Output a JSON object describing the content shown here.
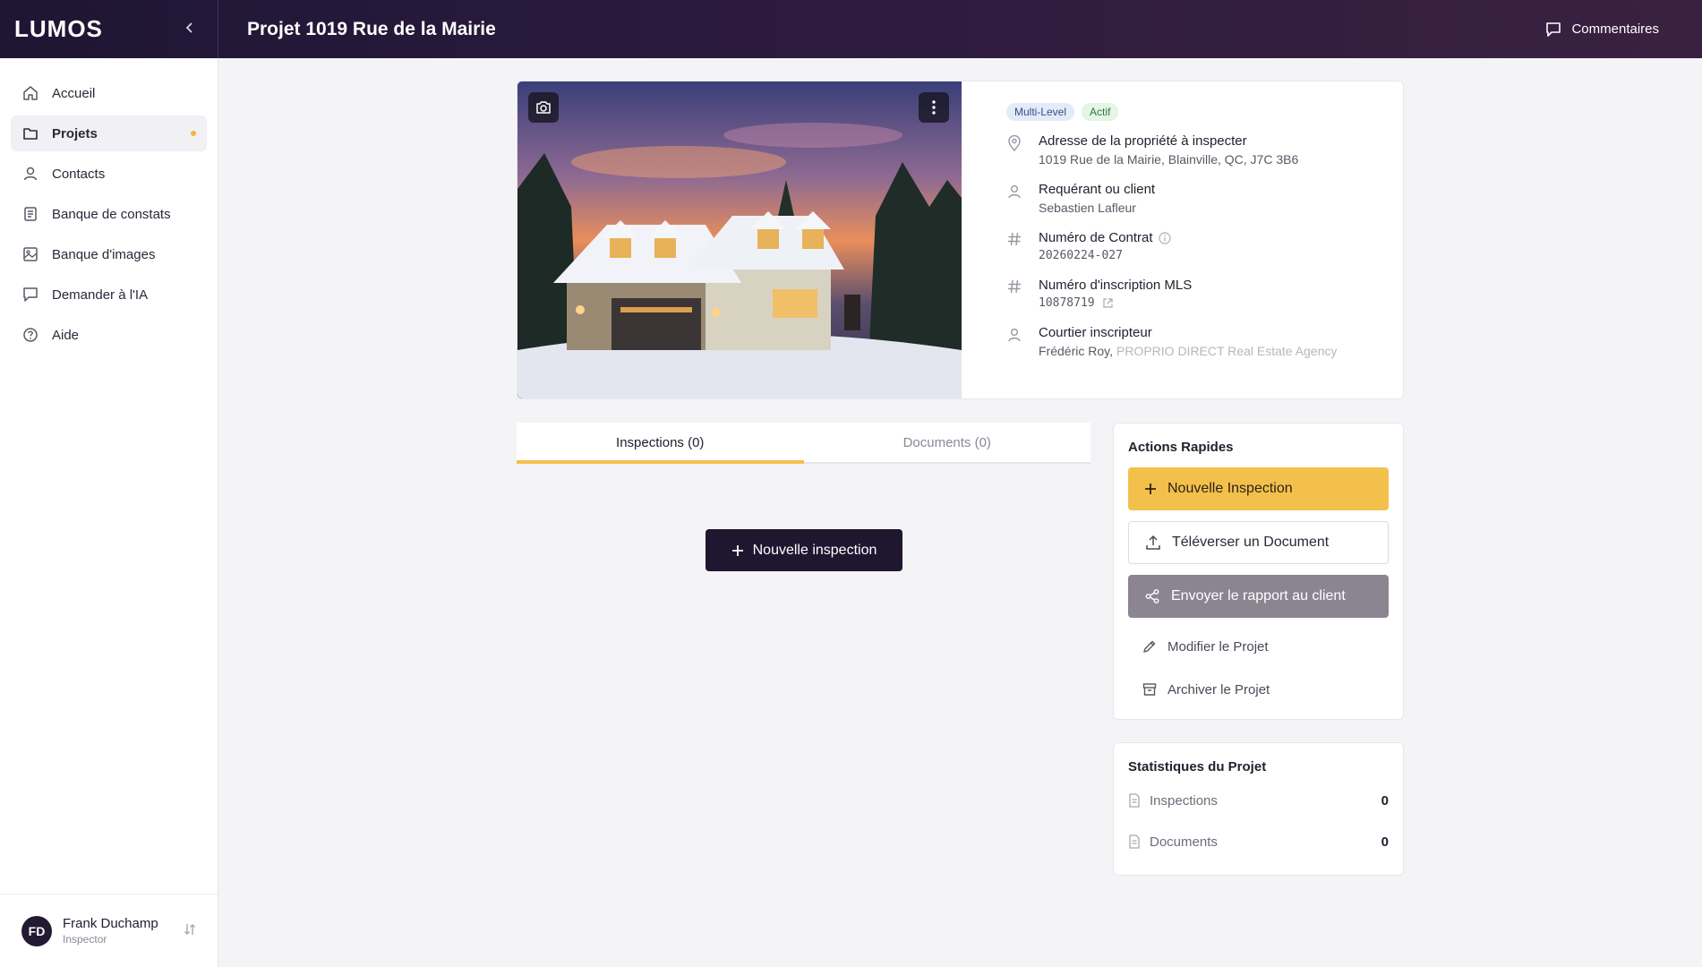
{
  "app": {
    "logo_text": "LUMOS",
    "page_title": "Projet 1019 Rue de la Mairie",
    "comments_label": "Commentaires"
  },
  "sidebar": {
    "items": [
      {
        "label": "Accueil",
        "icon": "home-icon"
      },
      {
        "label": "Projets",
        "icon": "folder-icon",
        "active": true
      },
      {
        "label": "Contacts",
        "icon": "user-icon"
      },
      {
        "label": "Banque de constats",
        "icon": "document-icon"
      },
      {
        "label": "Banque d'images",
        "icon": "image-icon"
      },
      {
        "label": "Demander à l'IA",
        "icon": "chat-icon"
      },
      {
        "label": "Aide",
        "icon": "help-icon"
      }
    ],
    "user": {
      "initials": "FD",
      "name": "Frank Duchamp",
      "role": "Inspector"
    }
  },
  "property": {
    "badges": {
      "type": "Multi-Level",
      "status": "Actif"
    },
    "address_label": "Adresse de la propriété à inspecter",
    "address_value": "1019 Rue de la Mairie, Blainville, QC, J7C 3B6",
    "client_label": "Requérant ou client",
    "client_value": "Sebastien Lafleur",
    "contract_label": "Numéro de Contrat",
    "contract_value": "20260224-027",
    "mls_label": "Numéro d'inscription MLS",
    "mls_value": "10878719",
    "broker_label": "Courtier inscripteur",
    "broker_name": "Frédéric Roy,",
    "broker_agency": "PROPRIO DIRECT Real Estate Agency"
  },
  "tabs": {
    "inspections": "Inspections (0)",
    "documents": "Documents (0)"
  },
  "main": {
    "new_inspection": "Nouvelle inspection"
  },
  "actions": {
    "title": "Actions Rapides",
    "new_inspection": "Nouvelle Inspection",
    "upload": "Téléverser un Document",
    "send_report": "Envoyer le rapport au client",
    "edit": "Modifier le Projet",
    "archive": "Archiver le Projet"
  },
  "stats": {
    "title": "Statistiques du Projet",
    "inspections_label": "Inspections",
    "inspections_value": "0",
    "documents_label": "Documents",
    "documents_value": "0"
  },
  "colors": {
    "accent": "#f4c04c",
    "dark": "#1f1630"
  }
}
